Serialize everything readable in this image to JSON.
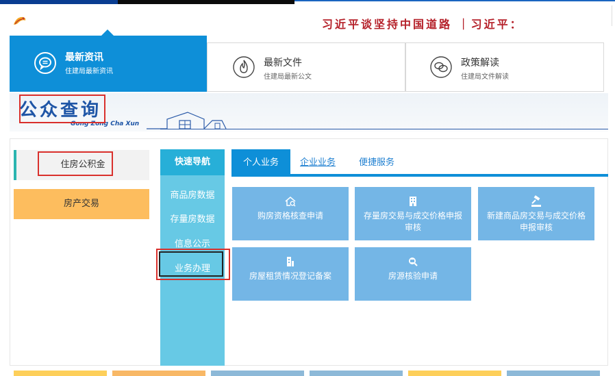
{
  "ticker": {
    "text": "习近平谈坚持中国道路 ｜习近平："
  },
  "tabs": [
    {
      "title": "最新资讯",
      "subtitle": "住建局最新资讯",
      "icon": "chat-icon",
      "active": true
    },
    {
      "title": "最新文件",
      "subtitle": "住建局最新公文",
      "icon": "flame-icon",
      "active": false
    },
    {
      "title": "政策解读",
      "subtitle": "住建局文件解读",
      "icon": "speech-bubbles-icon",
      "active": false
    }
  ],
  "section": {
    "title": "公众查询",
    "pinyin": "Gong Zong Cha Xun"
  },
  "categories": [
    {
      "label": "住房公积金"
    },
    {
      "label": "房产交易"
    }
  ],
  "quicknav": {
    "header": "快速导航",
    "items": [
      "商品房数据",
      "存量房数据",
      "信息公示",
      "业务办理"
    ]
  },
  "biz_tabs": [
    "个人业务",
    "企业业务",
    "便捷服务"
  ],
  "tiles": [
    {
      "label": "购房资格核查申请",
      "icon": "house-search-icon"
    },
    {
      "label": "存量房交易与成交价格申报审核",
      "icon": "building-icon"
    },
    {
      "label": "新建商品房交易与成交价格申报审核",
      "icon": "gavel-icon"
    },
    {
      "label": "房屋租赁情况登记备案",
      "icon": "rental-building-icon"
    },
    {
      "label": "房源核验申请",
      "icon": "house-verify-icon"
    }
  ],
  "colors": {
    "accent_blue": "#0e8fd8",
    "tile_blue": "#74b6e6",
    "quicknav_bg": "#67c9e5",
    "property_orange": "#fdbd5e",
    "highlight_red": "#d9302c",
    "ticker_red": "#b5212a"
  }
}
